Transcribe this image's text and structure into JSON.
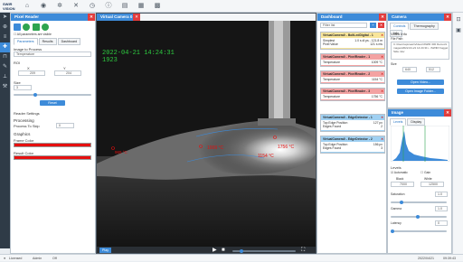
{
  "app": {
    "logo": "SWIR VISION"
  },
  "left_panel": {
    "title": "Pixel Reader",
    "checkbox_label": "All parameters are visible",
    "tabs": [
      "Parameters",
      "Results",
      "Dashboard"
    ],
    "roi_label": "Image to Process",
    "roi_value": "Temperature",
    "roi_section": "ROI",
    "x_label": "X",
    "y_label": "Y",
    "x_value": "209",
    "y_value": "204",
    "size_label": "Size",
    "size_value": "3",
    "reset": "Reset",
    "reader_settings": "Reader Settings",
    "processing": "Processing",
    "process_label": "Process To Skip",
    "process_value": "0",
    "graphics": "Graphics",
    "frame_color": "Frame Color",
    "result_color": "Result Color",
    "frame_color_hex": "#e60f0f",
    "result_color_hex": "#e60f0f"
  },
  "camera_view": {
    "title": "Virtual Camera 0",
    "timestamp": "2022-04-21 14:24:31",
    "frame": "1923",
    "label_1": "965 °C",
    "label_2": "1009 °C",
    "label_3": "1154 °C",
    "label_4": "1756 °C",
    "toolbar_label": "Play"
  },
  "dashboard": {
    "title": "Dashboard",
    "filter_placeholder": "Filter list",
    "cards": [
      {
        "title": "VirtualCamera0 - BoltLedDigital - 1",
        "l1": "Simplest",
        "v1": "1.0 s dl ps - 121.8 m",
        "l2": "Pixel Value",
        "v2": "121 s ms",
        "color": "#f8e59a"
      },
      {
        "title": "VirtualCamera0 - PixelReader - 1",
        "l1": "Temperature",
        "v1": "1009 °C",
        "l2": "",
        "v2": "",
        "color": "#f3a2a2"
      },
      {
        "title": "VirtualCamera0 - PixelReader - 2",
        "l1": "Temperature",
        "v1": "1154 °C",
        "l2": "",
        "v2": "",
        "color": "#f3a2a2"
      },
      {
        "title": "VirtualCamera0 - PixelReader - 3",
        "l1": "Temperature",
        "v1": "1756 °C",
        "l2": "",
        "v2": "",
        "color": "#f3a2a2"
      },
      {
        "title": "VirtualCamera0 - EdgeDetector - 1",
        "l1": "Top Edge Position",
        "v1": "127 px",
        "l2": "Edges Found",
        "v2": "2",
        "color": "#9fd0f2"
      },
      {
        "title": "VirtualCamera0 - EdgeDetector - 2",
        "l1": "Top Edge Position",
        "v1": "156 px",
        "l2": "Edges Found",
        "v2": "3",
        "color": "#9fd0f2"
      }
    ]
  },
  "camera_panel": {
    "title": "Camera",
    "tabs": [
      "Controls",
      "Thermography",
      "Info"
    ],
    "video_info": "Video Info",
    "file_path_label": "File Path",
    "file_path": "C:\\Users\\spiceas\\Videos\\SWIR 300 Demos\\Images\\2022-04-21 14:24:31\\...\\SWIR Nugget Side.mkv",
    "size_label": "Size",
    "width": "640",
    "height": "512",
    "open_video": "Open Video...",
    "open_image_folder": "Open Image Folder..."
  },
  "image_panel": {
    "title": "Image",
    "tabs": [
      "Levels",
      "Display"
    ],
    "levels_label": "Levels",
    "automatic_label": "Automatic",
    "gain_label": "Gain",
    "black_label": "Black",
    "white_label": "White",
    "black_value": "7000",
    "white_value": "12500",
    "saturation_label": "Saturation",
    "saturation_value": "1.0",
    "gamma_label": "Gamma",
    "gamma_value": "1.0",
    "latency_label": "Latency",
    "latency_value": "0"
  },
  "status": {
    "user": "Licensed",
    "role": "Admin",
    "mode": "Off",
    "date": "2022/04/21",
    "time": "09:39:43"
  }
}
